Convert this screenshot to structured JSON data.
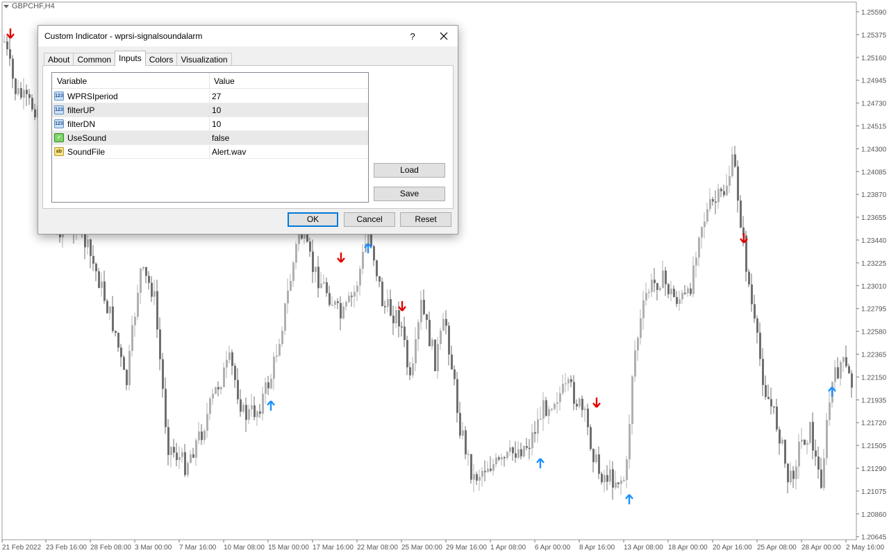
{
  "chart": {
    "symbol": "GBPCHF,H4",
    "colors": {
      "background": "#ffffff",
      "bull_candle": "#b0b0b0",
      "bear_candle": "#6e6e6e",
      "up_arrow": "#1e90ff",
      "down_arrow": "#e00000",
      "axis": "#777777"
    },
    "price_axis": [
      "1.25590",
      "1.25375",
      "1.25160",
      "1.24945",
      "1.24730",
      "1.24515",
      "1.24300",
      "1.24085",
      "1.23870",
      "1.23655",
      "1.23440",
      "1.23225",
      "1.23010",
      "1.22795",
      "1.22580",
      "1.22365",
      "1.22150",
      "1.21935",
      "1.21720",
      "1.21505",
      "1.21290",
      "1.21075",
      "1.20860",
      "1.20645"
    ],
    "time_axis": [
      "21 Feb 2022",
      "23 Feb 16:00",
      "28 Feb 08:00",
      "3 Mar 00:00",
      "7 Mar 16:00",
      "10 Mar 08:00",
      "15 Mar 00:00",
      "17 Mar 16:00",
      "22 Mar 08:00",
      "25 Mar 00:00",
      "29 Mar 16:00",
      "1 Apr 08:00",
      "6 Apr 00:00",
      "8 Apr 16:00",
      "13 Apr 08:00",
      "18 Apr 00:00",
      "20 Apr 16:00",
      "25 Apr 08:00",
      "28 Apr 00:00",
      "2 May 16:00"
    ]
  },
  "dialog": {
    "title": "Custom Indicator - wprsi-signalsoundalarm",
    "help_label": "?",
    "close_icon": "close-icon",
    "tabs": [
      {
        "label": "About"
      },
      {
        "label": "Common"
      },
      {
        "label": "Inputs",
        "active": true
      },
      {
        "label": "Colors"
      },
      {
        "label": "Visualization"
      }
    ],
    "grid": {
      "col_variable": "Variable",
      "col_value": "Value",
      "rows": [
        {
          "icon": "number-icon",
          "icon_text": "123",
          "name": "WPRSIperiod",
          "value": "27"
        },
        {
          "icon": "number-icon",
          "icon_text": "123",
          "name": "filterUP",
          "value": "10"
        },
        {
          "icon": "number-icon",
          "icon_text": "123",
          "name": "filterDN",
          "value": "10"
        },
        {
          "icon": "bool-icon",
          "icon_text": "✓",
          "name": "UseSound",
          "value": "false"
        },
        {
          "icon": "string-icon",
          "icon_text": "ab",
          "name": "SoundFile",
          "value": "Alert.wav"
        }
      ]
    },
    "buttons": {
      "load": "Load",
      "save": "Save",
      "ok": "OK",
      "cancel": "Cancel",
      "reset": "Reset"
    }
  }
}
